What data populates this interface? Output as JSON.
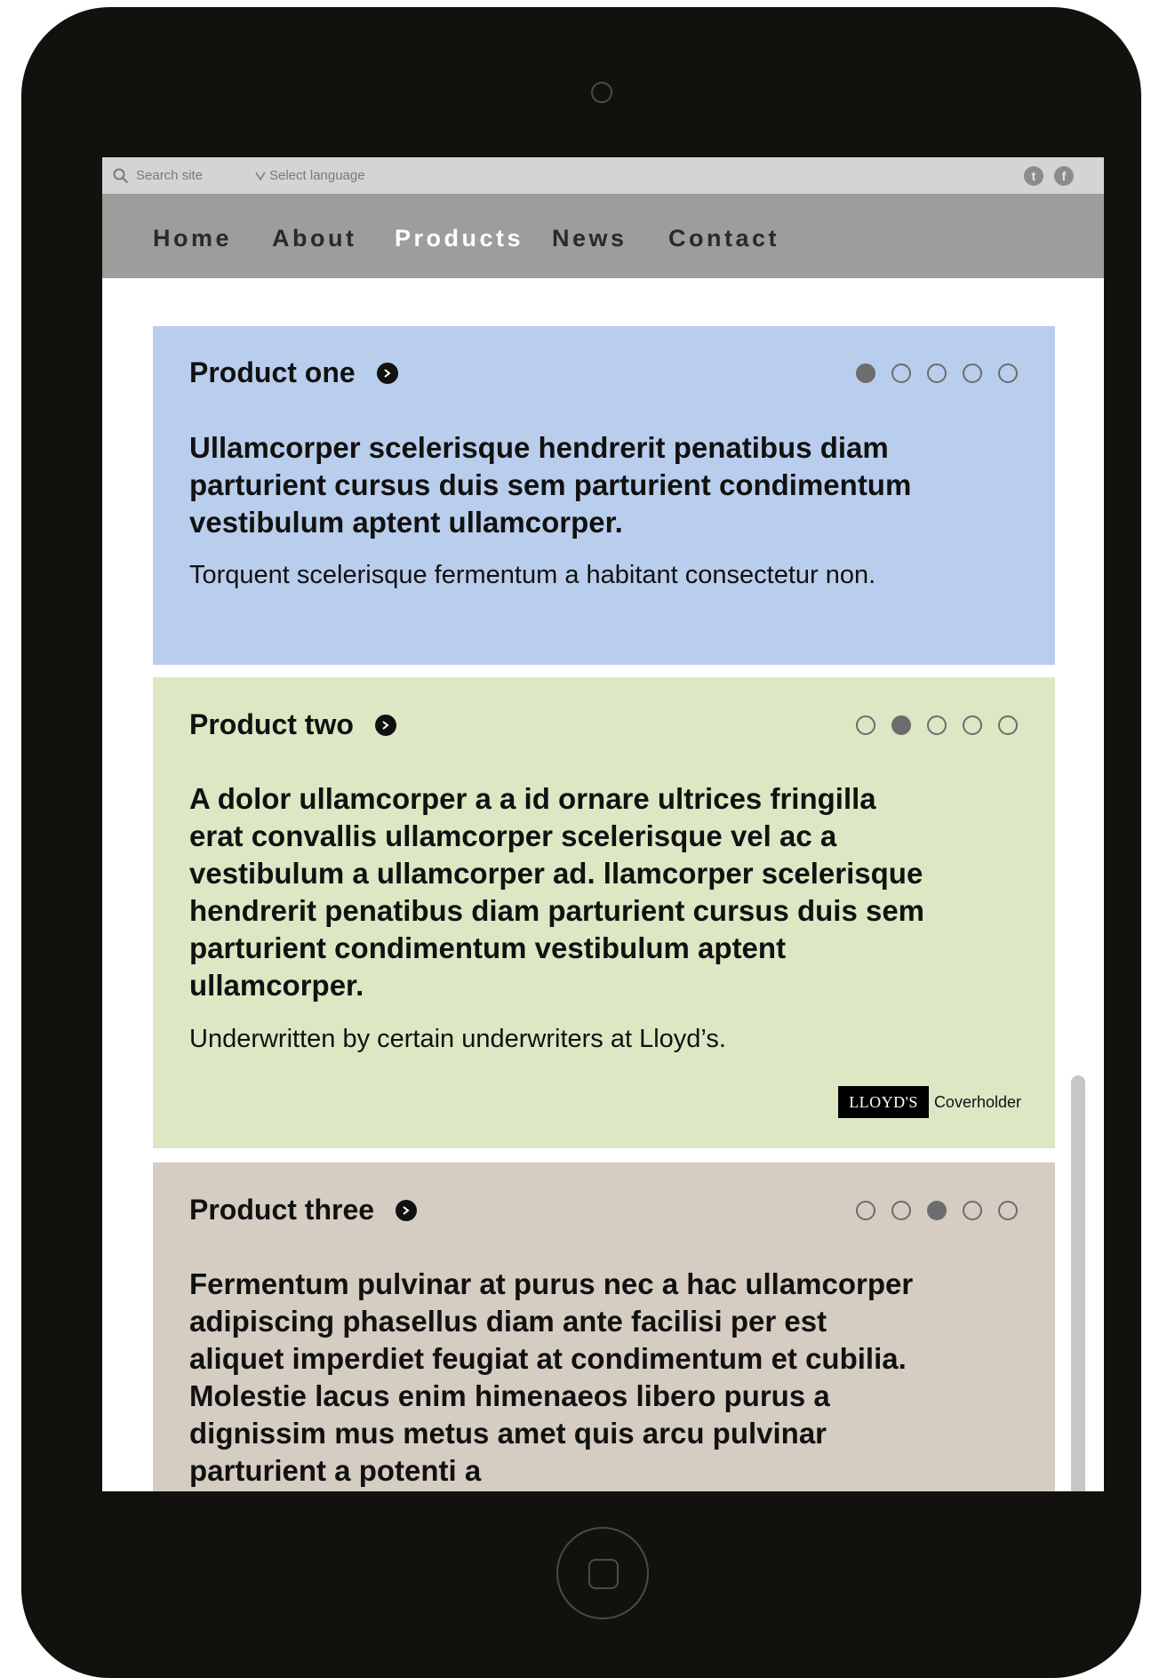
{
  "search": {
    "placeholder": "Search site"
  },
  "language": {
    "label": "Select language"
  },
  "social": {
    "twitter_glyph": "t",
    "facebook_glyph": "f"
  },
  "nav": {
    "items": [
      "Home",
      "About",
      "Products",
      "News",
      "Contact"
    ],
    "active": "Products"
  },
  "products": [
    {
      "title": "Product one",
      "active_dot": 1,
      "lead": "Ullamcorper scelerisque hendrerit penatibus diam parturient cursus duis sem parturient condimentum vestibulum aptent ullamcorper.",
      "sub": "Torquent scelerisque fermentum a habitant consectetur non.",
      "color": "#b9ceec"
    },
    {
      "title": "Product two",
      "active_dot": 2,
      "lead": "A dolor ullamcorper a a id ornare ultrices fringilla erat convallis ullamcorper scelerisque vel ac a vestibulum a ullamcorper ad. llamcorper scelerisque hendrerit penatibus diam parturient cursus duis sem parturient condimentum vestibulum aptent ullamcorper.",
      "sub": "Underwritten by certain underwriters at Lloyd’s.",
      "badge": {
        "logo": "LLOYD'S",
        "text": "Coverholder"
      },
      "color": "#dce7c4"
    },
    {
      "title": "Product three",
      "active_dot": 3,
      "lead": "Fermentum pulvinar at purus nec a hac ullamcorper adipiscing phasellus diam ante facilisi per est aliquet imperdiet feugiat at condimentum et cubilia. Molestie lacus enim himenaeos libero purus a dignissim mus metus amet quis arcu pulvinar parturient a potenti a",
      "color": "#d5cdc2"
    }
  ],
  "dot_count": 5,
  "colors": {
    "device": "#12110e",
    "utility_bar": "#d4d4d4",
    "nav_bar": "#9d9d9c"
  }
}
